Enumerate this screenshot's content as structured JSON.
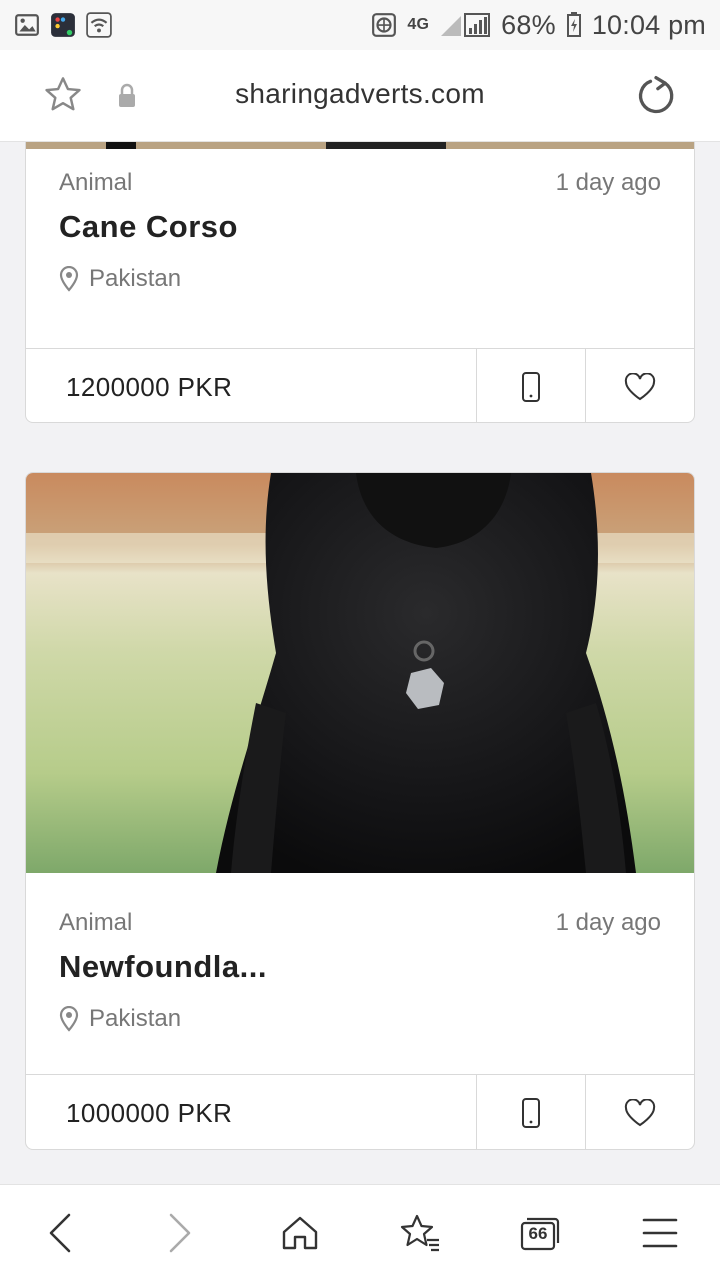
{
  "status_bar": {
    "battery": "68%",
    "time": "10:04 pm",
    "network": "4G",
    "icons": [
      "gallery-icon",
      "app-icon",
      "wifi-icon",
      "vpn-icon",
      "signal-icon",
      "battery-icon"
    ]
  },
  "browser": {
    "url": "sharingadverts.com",
    "icons": [
      "star-icon",
      "lock-icon",
      "reload-icon"
    ]
  },
  "listings": [
    {
      "category": "Animal",
      "posted": "1 day ago",
      "title": "Cane Corso",
      "location": "Pakistan",
      "price": "1200000 PKR"
    },
    {
      "category": "Animal",
      "posted": "1 day ago",
      "title": "Newfoundla...",
      "location": "Pakistan",
      "price": "1000000 PKR"
    }
  ],
  "bottom_nav": {
    "tab_count": "66",
    "icons": [
      "back-icon",
      "forward-icon",
      "home-icon",
      "bookmarks-icon",
      "tabs-icon",
      "menu-icon"
    ]
  },
  "colors": {
    "page_background": "#f2f2f4",
    "card_border": "#d9d9d9",
    "text_primary": "#222222",
    "text_secondary": "#777777"
  }
}
